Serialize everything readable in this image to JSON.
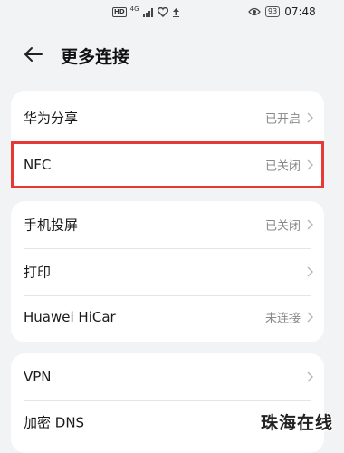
{
  "status_bar": {
    "hd_badge": "HD",
    "network_label": "4G",
    "battery": "93",
    "time": "07:48",
    "icons": [
      "signal-icon",
      "heart-icon",
      "upload-arrow-icon",
      "eye-icon",
      "battery-icon"
    ]
  },
  "header": {
    "title": "更多连接",
    "back_icon": "arrow-left-icon"
  },
  "groups": [
    {
      "items": [
        {
          "label": "华为分享",
          "status": "已开启"
        },
        {
          "label": "NFC",
          "status": "已关闭"
        }
      ]
    },
    {
      "items": [
        {
          "label": "手机投屏",
          "status": "已关闭"
        },
        {
          "label": "打印",
          "status": ""
        },
        {
          "label": "Huawei HiCar",
          "status": "未连接"
        }
      ]
    },
    {
      "items": [
        {
          "label": "VPN",
          "status": ""
        },
        {
          "label": "加密 DNS",
          "status": ""
        }
      ]
    }
  ],
  "highlight": {
    "target": "NFC",
    "color": "#e53935"
  },
  "watermark": "珠海在线",
  "colors": {
    "background": "#f1f3f5",
    "card": "#ffffff",
    "secondary_text": "#888888"
  }
}
